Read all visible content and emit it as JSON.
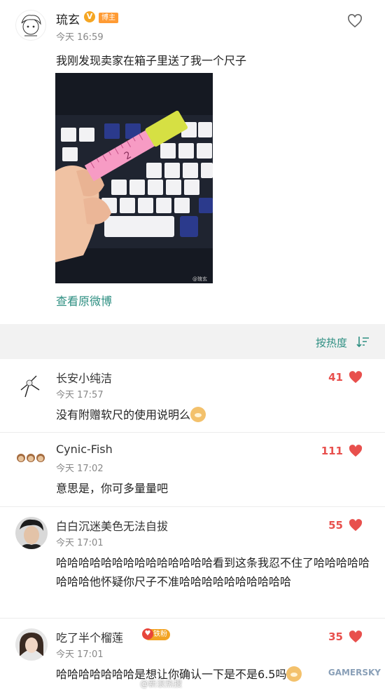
{
  "post": {
    "author": "琉玄",
    "verified_mark": "V",
    "role_badge": "博主",
    "time": "今天 16:59",
    "text": "我刚发现卖家在箱子里送了我一个尺子",
    "image_watermark": "@琉玄",
    "view_original": "查看原微博"
  },
  "sort": {
    "label": "按热度"
  },
  "comments": [
    {
      "name": "长安小纯洁",
      "time": "今天 17:57",
      "text": "没有附赠软尺的使用说明么",
      "likes": "41"
    },
    {
      "name": "Cynic-Fish",
      "time": "今天 17:02",
      "text": "意思是，你可多量量吧",
      "likes": "111"
    },
    {
      "name": "白白沉迷美色无法自拔",
      "time": "今天 17:01",
      "text": "哈哈哈哈哈哈哈哈哈哈哈哈哈哈看到这条我忍不住了哈哈哈哈哈哈哈哈他怀疑你尺子不准哈哈哈哈哈哈哈哈哈哈",
      "likes": "55"
    },
    {
      "name": "吃了半个榴莲",
      "badge": "铁粉",
      "time": "今天 17:01",
      "text": "哈哈哈哈哈哈哈是想让你确认一下是不是6.5吗",
      "likes": "35"
    }
  ],
  "footer": {
    "watermark": "@新浪热搜",
    "brand": "GAMERSKY"
  },
  "colors": {
    "accent": "#2e8f82",
    "like": "#e8504d",
    "badge": "#ff9b34"
  }
}
